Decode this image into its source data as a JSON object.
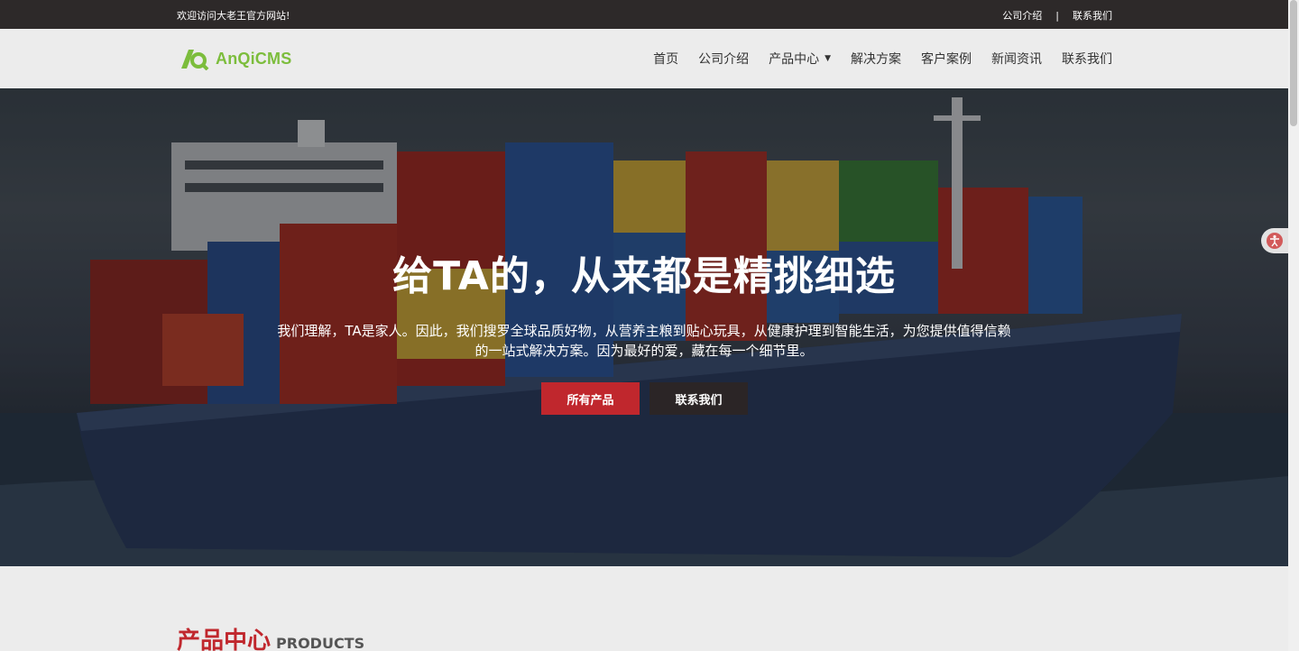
{
  "topbar": {
    "welcome": "欢迎访问大老王官方网站!",
    "links": [
      "公司介绍",
      "联系我们"
    ],
    "separator": "|"
  },
  "header": {
    "logo_text": "AnQiCMS",
    "nav": [
      {
        "label": "首页"
      },
      {
        "label": "公司介绍"
      },
      {
        "label": "产品中心",
        "has_dropdown": true
      },
      {
        "label": "解决方案"
      },
      {
        "label": "客户案例"
      },
      {
        "label": "新闻资讯"
      },
      {
        "label": "联系我们"
      }
    ]
  },
  "hero": {
    "title": "给TA的，从来都是精挑细选",
    "description": "我们理解，TA是家人。因此，我们搜罗全球品质好物，从营养主粮到贴心玩具，从健康护理到智能生活，为您提供值得信赖的一站式解决方案。因为最好的爱，藏在每一个细节里。",
    "primary_button": "所有产品",
    "secondary_button": "联系我们"
  },
  "products_section": {
    "title_cn": "产品中心",
    "title_en": "PRODUCTS"
  },
  "colors": {
    "brand_red": "#c0272d",
    "topbar_bg": "#2d2929",
    "logo_green": "#7cbd3c"
  }
}
